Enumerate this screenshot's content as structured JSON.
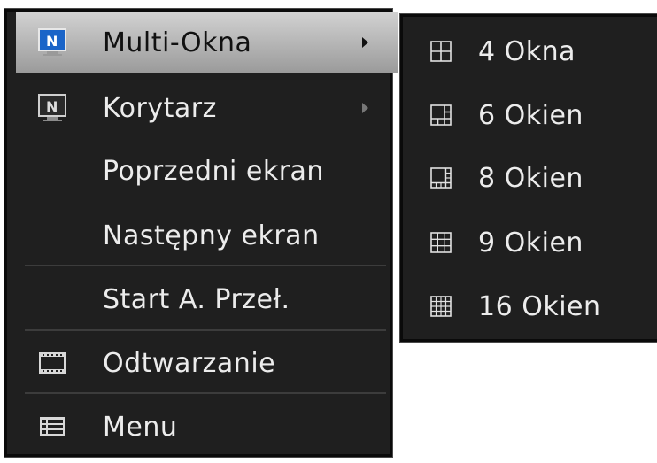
{
  "main_menu": {
    "items": [
      {
        "label": "Multi-Okna",
        "icon": "monitor-n-icon",
        "has_submenu": true,
        "highlighted": true
      },
      {
        "label": "Korytarz",
        "icon": "monitor-n-icon",
        "has_submenu": true
      },
      {
        "label": "Poprzedni ekran"
      },
      {
        "label": "Następny ekran"
      },
      {
        "label": "Start A. Przeł."
      },
      {
        "label": "Odtwarzanie",
        "icon": "film-icon"
      },
      {
        "label": "Menu",
        "icon": "list-icon"
      }
    ]
  },
  "submenu": {
    "items": [
      {
        "label": "4 Okna",
        "icon": "grid-4-icon"
      },
      {
        "label": "6 Okien",
        "icon": "grid-6-icon"
      },
      {
        "label": "8 Okien",
        "icon": "grid-8-icon"
      },
      {
        "label": "9 Okien",
        "icon": "grid-9-icon"
      },
      {
        "label": "16 Okien",
        "icon": "grid-16-icon"
      }
    ]
  },
  "colors": {
    "menu_bg": "#1f1f1f",
    "highlight_top": "#d2d2d2",
    "highlight_bottom": "#9a9a9a",
    "text": "#ececec",
    "separator": "#3c3c3c",
    "icon_blue": "#1a64c8"
  }
}
